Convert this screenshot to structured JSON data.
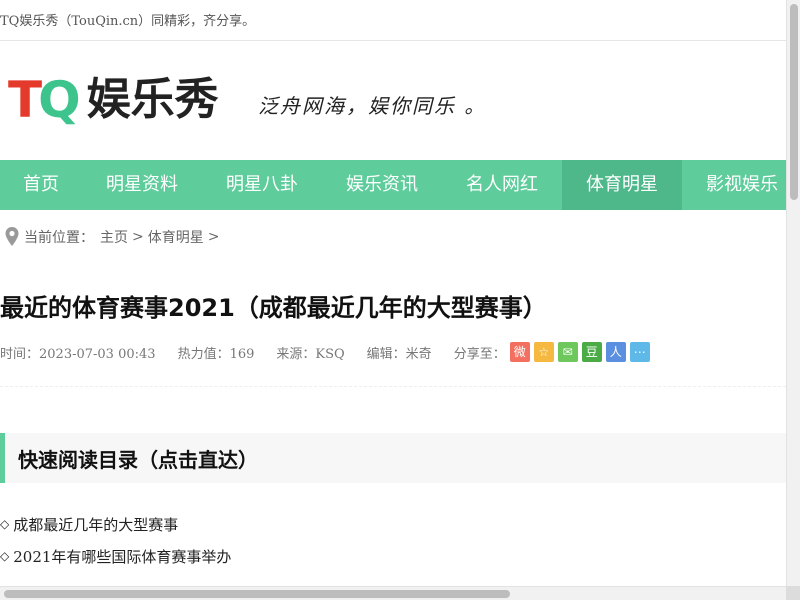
{
  "topbar": {
    "text": "TQ娱乐秀（TouQin.cn）同精彩，齐分享。"
  },
  "logo": {
    "tq_t": "T",
    "tq_q": "Q",
    "cn": "娱乐秀",
    "colors": {
      "t": "#e33a2c",
      "q": "#3cc48c"
    }
  },
  "slogan": "泛舟网海，娱你同乐 。",
  "nav": {
    "accent": "#5fcc9c",
    "items": [
      {
        "label": "首页",
        "active": false
      },
      {
        "label": "明星资料",
        "active": false
      },
      {
        "label": "明星八卦",
        "active": false
      },
      {
        "label": "娱乐资讯",
        "active": false
      },
      {
        "label": "名人网红",
        "active": false
      },
      {
        "label": "体育明星",
        "active": true
      },
      {
        "label": "影视娱乐",
        "active": false
      }
    ]
  },
  "breadcrumb": {
    "prefix": "当前位置：",
    "items": [
      "主页",
      "体育明星"
    ],
    "sep": ">"
  },
  "article": {
    "title": "最近的体育赛事2021（成都最近几年的大型赛事）",
    "meta": {
      "time": "时间：2023-07-03 00:43",
      "heat": "热力值：169",
      "source": "来源：KSQ",
      "editor": "编辑：米奇",
      "share_label": "分享至："
    },
    "share_icons": [
      {
        "name": "weibo-icon",
        "glyph": "微",
        "color": "#f36f5f"
      },
      {
        "name": "qzone-icon",
        "glyph": "☆",
        "color": "#f5b942"
      },
      {
        "name": "wechat-icon",
        "glyph": "✉",
        "color": "#6dc75c"
      },
      {
        "name": "douban-icon",
        "glyph": "豆",
        "color": "#4aab47"
      },
      {
        "name": "renren-icon",
        "glyph": "人",
        "color": "#5b8fe0"
      },
      {
        "name": "more-share-icon",
        "glyph": "⋯",
        "color": "#5fb9e8"
      }
    ]
  },
  "toc": {
    "title": "快速阅读目录（点击直达）",
    "marker": "◇",
    "items": [
      "成都最近几年的大型赛事",
      "2021年有哪些国际体育赛事举办"
    ]
  }
}
